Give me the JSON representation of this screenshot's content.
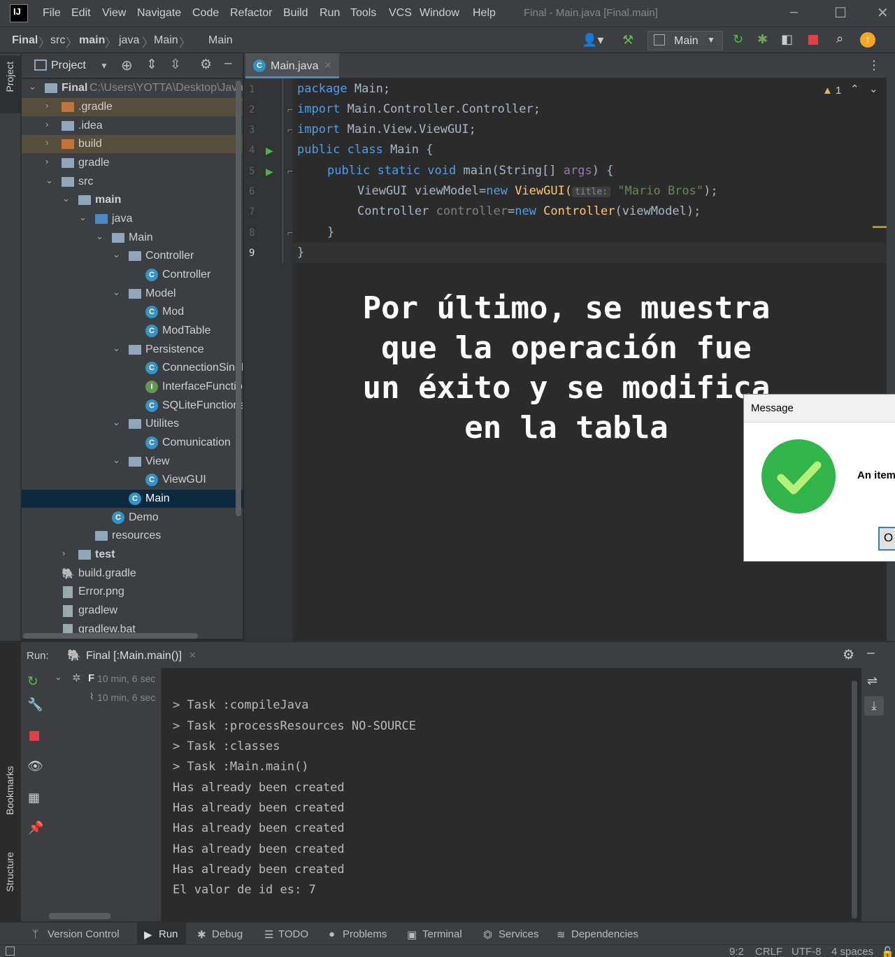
{
  "app": {
    "logo": "IJ",
    "window_title": "Final - Main.java [Final.main]",
    "menu": [
      "File",
      "Edit",
      "View",
      "Navigate",
      "Code",
      "Refactor",
      "Build",
      "Run",
      "Tools",
      "VCS",
      "Window",
      "Help"
    ]
  },
  "breadcrumb": [
    "Final",
    "src",
    "main",
    "java",
    "Main",
    "Main"
  ],
  "toolbar": {
    "run_config": "Main"
  },
  "project": {
    "title": "Project",
    "root_name": "Final",
    "root_path": "C:\\Users\\YOTTA\\Desktop\\Java\\",
    "items": [
      {
        "label": ".gradle"
      },
      {
        "label": ".idea"
      },
      {
        "label": "build"
      },
      {
        "label": "gradle"
      },
      {
        "label": "src"
      },
      {
        "label": "main"
      },
      {
        "label": "java"
      },
      {
        "label": "Main"
      },
      {
        "label": "Controller"
      },
      {
        "label": "Controller"
      },
      {
        "label": "Model"
      },
      {
        "label": "Mod"
      },
      {
        "label": "ModTable"
      },
      {
        "label": "Persistence"
      },
      {
        "label": "ConnectionSingleton"
      },
      {
        "label": "InterfaceFunctions"
      },
      {
        "label": "SQLiteFunctions"
      },
      {
        "label": "Utilites"
      },
      {
        "label": "Comunication"
      },
      {
        "label": "View"
      },
      {
        "label": "ViewGUI"
      },
      {
        "label": "Main"
      },
      {
        "label": "Demo"
      },
      {
        "label": "resources"
      },
      {
        "label": "test"
      },
      {
        "label": "build.gradle"
      },
      {
        "label": "Error.png"
      },
      {
        "label": "gradlew"
      },
      {
        "label": "gradlew.bat"
      }
    ]
  },
  "editor": {
    "tab": "Main.java",
    "warnings": "1",
    "line_numbers": [
      "1",
      "2",
      "3",
      "4",
      "5",
      "6",
      "7",
      "8",
      "9"
    ],
    "code": {
      "l1_kw": "package",
      "l1_rest": " Main;",
      "l2_kw": "import",
      "l2_rest": " Main.Controller.Controller;",
      "l3_kw": "import",
      "l3_rest": " Main.View.ViewGUI;",
      "l4_kw": "public class",
      "l4_rest": " Main {",
      "l5_kw": "public static void",
      "l5_name": " main(String[] ",
      "l5_param": "args",
      "l5_end": ") {",
      "l6_a": "ViewGUI viewModel=",
      "l6_new": "new",
      "l6_cls": " ViewGUI(",
      "l6_hint": "title:",
      "l6_str": "\"Mario Bros\"",
      "l6_end": ");",
      "l7_a": "Controller ",
      "l7_var": "controller",
      "l7_eq": "=",
      "l7_new": "new",
      "l7_cls": " Controller",
      "l7_end": "(viewModel);",
      "l8": "}",
      "l9": "}"
    }
  },
  "overlay": {
    "lines": [
      "Por último, se muestra",
      "que la operación fue",
      "un éxito y se modifica",
      "en la tabla"
    ]
  },
  "dialog": {
    "title": "Message",
    "message": "An item",
    "ok": "O"
  },
  "run": {
    "label": "Run:",
    "tab": "Final [:Main.main()]",
    "tree": [
      {
        "label": "F",
        "time": "10 min, 6 sec"
      },
      {
        "label": "",
        "time": "10 min, 6 sec"
      }
    ],
    "partial_top": "",
    "console": [
      "> Task :compileJava",
      "> Task :processResources NO-SOURCE",
      "> Task :classes",
      "> Task :Main.main()",
      "Has already been created",
      "Has already been created",
      "Has already been created",
      "Has already been created",
      "Has already been created",
      "El valor de id es: 7"
    ]
  },
  "bottom_tabs": [
    "Version Control",
    "Run",
    "Debug",
    "TODO",
    "Problems",
    "Terminal",
    "Services",
    "Dependencies"
  ],
  "side_tabs": {
    "project": "Project",
    "bookmarks": "Bookmarks",
    "structure": "Structure"
  },
  "status": {
    "position": "9:2",
    "line_sep": "CRLF",
    "encoding": "UTF-8",
    "indent": "4 spaces"
  },
  "colors": {
    "accent": "#4a88c7",
    "selection": "#0d293e",
    "highlight": "#564d3a",
    "success": "#31b54a"
  }
}
